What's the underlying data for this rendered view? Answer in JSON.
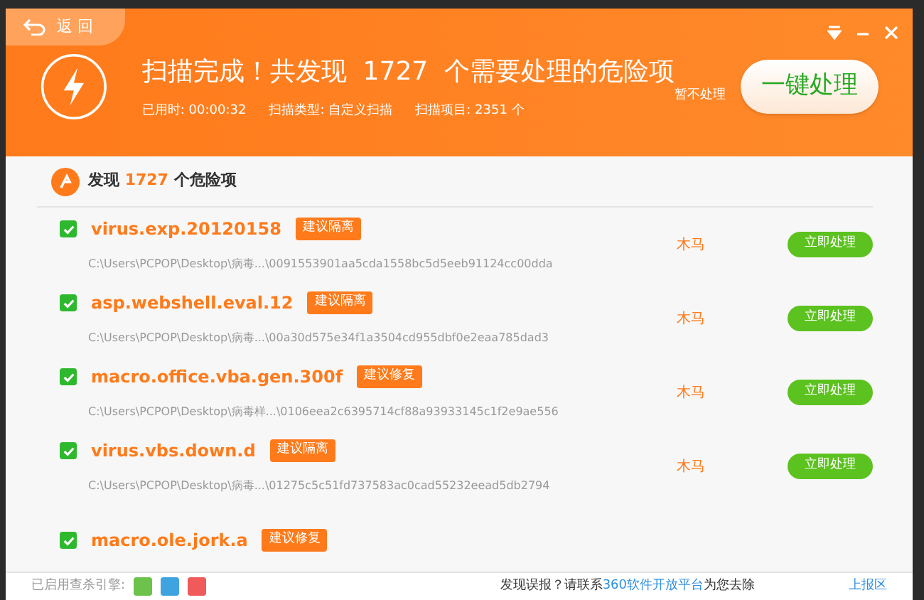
{
  "header": {
    "back_label": "返 回",
    "title": "扫描完成！共发现  1727  个需要处理的危险项",
    "stats": [
      {
        "label": "已用时:",
        "value": "00:00:32"
      },
      {
        "label": "扫描类型:",
        "value": "自定义扫描"
      },
      {
        "label": "扫描项目:",
        "value": "2351 个"
      }
    ],
    "skip_label": "暂不处理",
    "primary_button": "一键处理"
  },
  "summary": {
    "prefix": "发现",
    "count": "1727",
    "suffix": "个危险项"
  },
  "threats": [
    {
      "checked": true,
      "name": "virus.exp.20120158",
      "tag": "建议隔离",
      "path": "C:\\Users\\PCPOP\\Desktop\\病毒...\\0091553901aa5cda1558bc5d5eeb91124cc00dda",
      "type": "木马",
      "action": "立即处理"
    },
    {
      "checked": true,
      "name": "asp.webshell.eval.12",
      "tag": "建议隔离",
      "path": "C:\\Users\\PCPOP\\Desktop\\病毒...\\00a30d575e34f1a3504cd955dbf0e2eaa785dad3",
      "type": "木马",
      "action": "立即处理"
    },
    {
      "checked": true,
      "name": "macro.office.vba.gen.300f",
      "tag": "建议修复",
      "path": "C:\\Users\\PCPOP\\Desktop\\病毒样...\\0106eea2c6395714cf88a93933145c1f2e9ae556",
      "type": "木马",
      "action": "立即处理"
    },
    {
      "checked": true,
      "name": "virus.vbs.down.d",
      "tag": "建议隔离",
      "path": "C:\\Users\\PCPOP\\Desktop\\病毒...\\01275c5c51fd737583ac0cad55232eead5db2794",
      "type": "木马",
      "action": "立即处理"
    },
    {
      "checked": true,
      "name": "macro.ole.jork.a",
      "tag": "建议修复"
    }
  ],
  "footer": {
    "engines_label": "已启用查杀引擎:",
    "engines": [
      {
        "color": "#6cc24a"
      },
      {
        "color": "#3fa3e0"
      },
      {
        "color": "#f05a5a"
      }
    ],
    "report_text": "发现误报？请联系",
    "report_link": "360软件开放平台",
    "report_suffix": "为您去除",
    "report_area": "上报区"
  }
}
